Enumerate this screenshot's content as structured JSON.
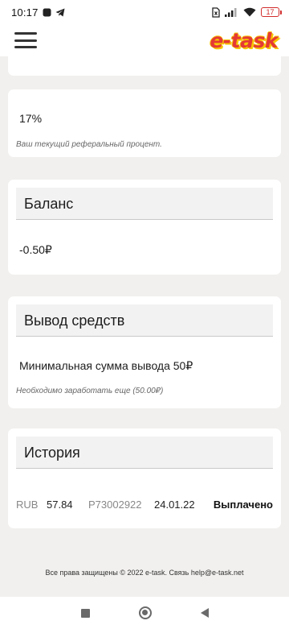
{
  "status_bar": {
    "time": "10:17",
    "battery": "17"
  },
  "header": {
    "logo": "e-task"
  },
  "referral": {
    "percent": "17%",
    "note": "Ваш текущий реферальный процент."
  },
  "balance": {
    "title": "Баланс",
    "value": "-0.50₽"
  },
  "withdraw": {
    "title": "Вывод средств",
    "min_text": "Минимальная сумма вывода 50₽",
    "note": "Необходимо заработать еще (50.00₽)"
  },
  "history": {
    "title": "История",
    "rows": [
      {
        "currency": "RUB",
        "amount": "57.84",
        "account": "P73002922",
        "date": "24.01.22",
        "status": "Выплачено"
      }
    ]
  },
  "footer": {
    "text": "Все права защищены © 2022 e-task. Связь help@e-task.net"
  }
}
